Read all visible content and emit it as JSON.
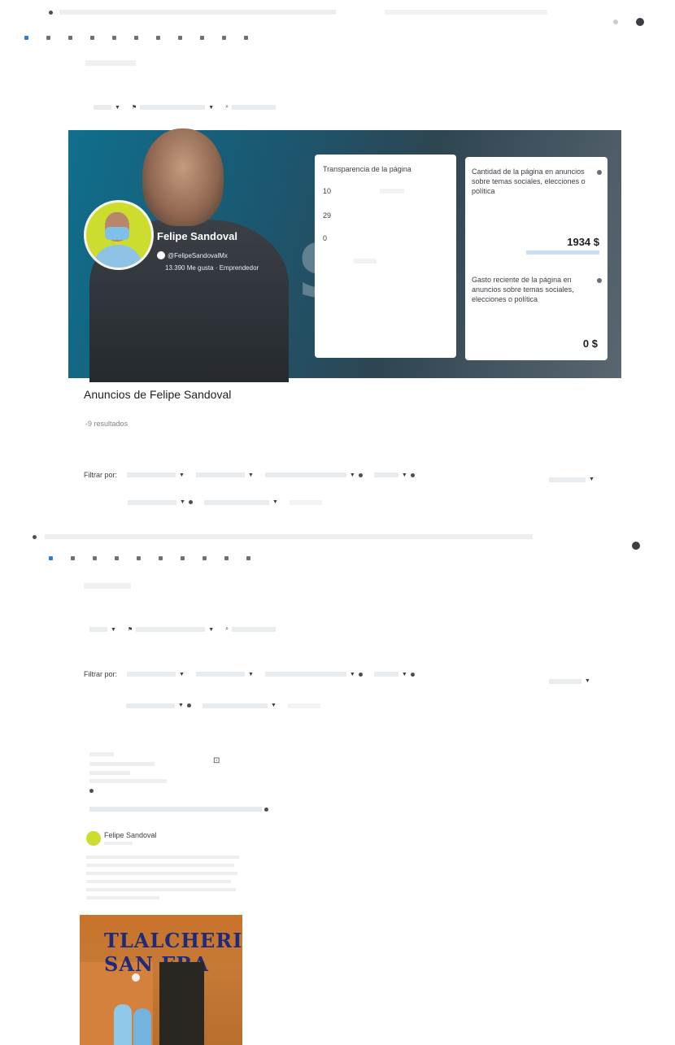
{
  "browser_top": {
    "tab_text": "",
    "bookmarks_count_note": ""
  },
  "banner": {
    "page_name": "Felipe Sandoval",
    "handle": "@FelipeSandovalMx",
    "likes": "13.390 Me gusta · Emprendedor",
    "watermark": "S"
  },
  "transparency_card": {
    "title": "Transparencia de la página",
    "rows": [
      "10",
      "29",
      "0"
    ]
  },
  "spend_card": {
    "label_1": "Cantidad de la página en anuncios sobre temas sociales, elecciones o política",
    "amount_1": "1934 $",
    "link_1": "",
    "label_2": "Gasto reciente de la página en anuncios sobre temas sociales, elecciones o política",
    "amount_2": "0 $"
  },
  "ads_section": {
    "title": "Anuncios de Felipe Sandoval",
    "results": "-9 resultados",
    "filter_label": "Filtrar por:",
    "filter_label_2": "Filtrar por:"
  },
  "ad_card": {
    "advertiser": "Felipe Sandoval",
    "store_sign": "TLALCHERIA SAN FRA"
  }
}
